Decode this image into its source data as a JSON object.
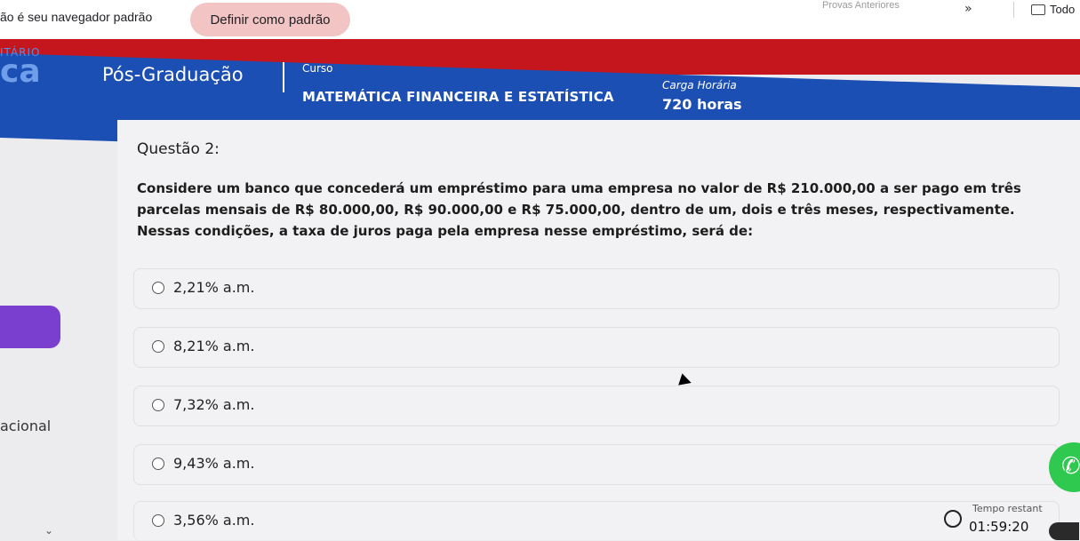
{
  "browser_bar": {
    "notice": "ão é seu navegador padrão",
    "default_button": "Definir como padrão",
    "faded_text": "Provas Anteriores",
    "chevron": "»",
    "folder_label": "Todo"
  },
  "header": {
    "logo_small": "ITÁRIO",
    "logo_big": "ca",
    "program": "Pós-Graduação",
    "course_label": "Curso",
    "course_name": "MATEMÁTICA FINANCEIRA E ESTATÍSTICA",
    "hours_label": "Carga Horária",
    "hours_value": "720 horas"
  },
  "question": {
    "title": "Questão 2:",
    "lines": [
      "Considere um banco que concederá um empréstimo para uma empresa no valor de R$ 210.000,00 a ser pago em três",
      "parcelas mensais de R$ 80.000,00, R$ 90.000,00 e R$ 75.000,00, dentro de um, dois e três meses, respectivamente.",
      "Nessas condições, a taxa de juros paga pela empresa nesse empréstimo, será de:"
    ],
    "options": [
      "2,21% a.m.",
      "8,21% a.m.",
      "7,32% a.m.",
      "9,43% a.m.",
      "3,56% a.m."
    ]
  },
  "sidebar_left_text": "acional",
  "timer": {
    "label": "Tempo restant",
    "value": "01:59:20"
  },
  "colors": {
    "red_band": "#c4161c",
    "blue_header": "#1c4fb4",
    "whatsapp": "#2fc94f",
    "purple": "#7a3fcf"
  }
}
